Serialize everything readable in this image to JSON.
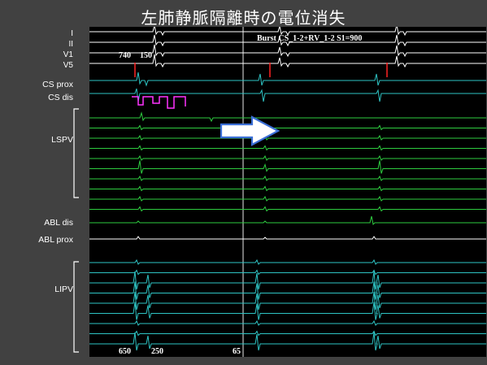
{
  "title": "左肺静脈隔離時の電位消失",
  "channels": {
    "I": "I",
    "II": "II",
    "V1": "V1",
    "V5": "V5",
    "cs_prox": "CS prox",
    "cs_dis": "CS dis",
    "lspv": "LSPV",
    "abl_dis": "ABL  dis",
    "abl_prox": "ABL prox",
    "lipv": "LIPV"
  },
  "annotations": {
    "interval_1": "740",
    "interval_2": "150",
    "pacing": "Burst CS_1-2+RV_1-2 S1=900",
    "bottom_1": "650",
    "bottom_2": "250",
    "bottom_3": "65"
  },
  "colors": {
    "background": "#414141",
    "tracing_bg": "#000000",
    "ecg": "#ffffff",
    "cs": "#2ec4c4",
    "cs_dis": "#ff33ff",
    "lspv": "#2ecc40",
    "lipv": "#2ec4c4",
    "marker": "#ff2222",
    "arrow_fill": "#ffffff",
    "arrow_stroke": "#3b6fd6"
  },
  "arrow_icon": "right-arrow-icon"
}
